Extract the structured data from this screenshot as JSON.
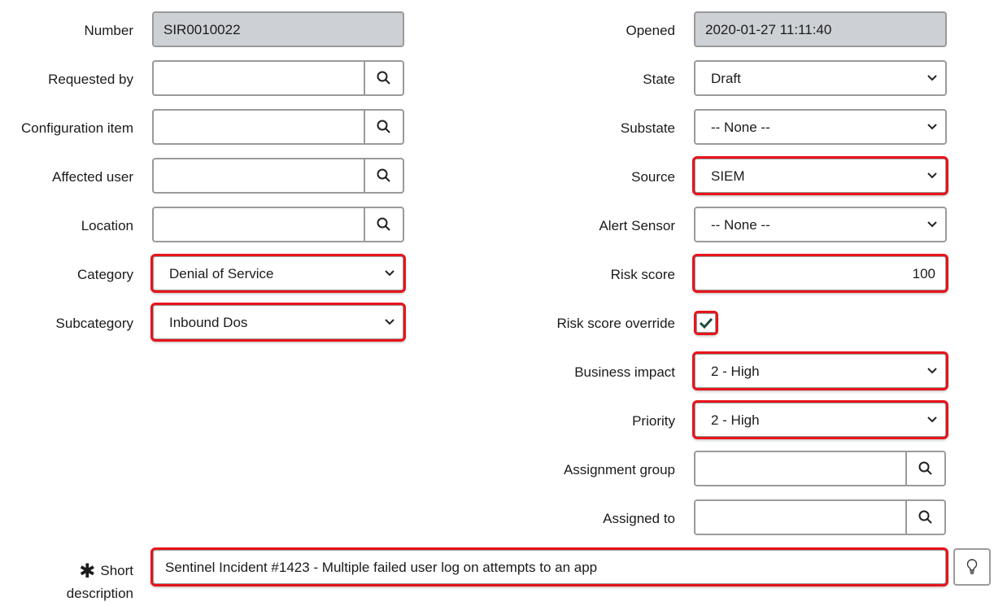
{
  "left": {
    "number": {
      "label": "Number",
      "value": "SIR0010022"
    },
    "requested_by": {
      "label": "Requested by",
      "value": ""
    },
    "configuration_item": {
      "label": "Configuration item",
      "value": ""
    },
    "affected_user": {
      "label": "Affected user",
      "value": ""
    },
    "location": {
      "label": "Location",
      "value": ""
    },
    "category": {
      "label": "Category",
      "value": "Denial of Service"
    },
    "subcategory": {
      "label": "Subcategory",
      "value": "Inbound Dos"
    }
  },
  "right": {
    "opened": {
      "label": "Opened",
      "value": "2020-01-27 11:11:40"
    },
    "state": {
      "label": "State",
      "value": "Draft"
    },
    "substate": {
      "label": "Substate",
      "value": "-- None --"
    },
    "source": {
      "label": "Source",
      "value": "SIEM"
    },
    "alert_sensor": {
      "label": "Alert Sensor",
      "value": "-- None --"
    },
    "risk_score": {
      "label": "Risk score",
      "value": "100"
    },
    "risk_score_override": {
      "label": "Risk score override",
      "checked": true
    },
    "business_impact": {
      "label": "Business impact",
      "value": "2 - High"
    },
    "priority": {
      "label": "Priority",
      "value": "2 - High"
    },
    "assignment_group": {
      "label": "Assignment group",
      "value": ""
    },
    "assigned_to": {
      "label": "Assigned to",
      "value": ""
    }
  },
  "short_description": {
    "required_mark": "✱",
    "label_line1": "Short",
    "label_line2": "description",
    "value": "Sentinel Incident #1423 - Multiple failed user log on attempts to an app"
  },
  "colors": {
    "highlight": "#e8141b",
    "readonly_bg": "#cdd1d5",
    "check": "#1e4a3a"
  }
}
